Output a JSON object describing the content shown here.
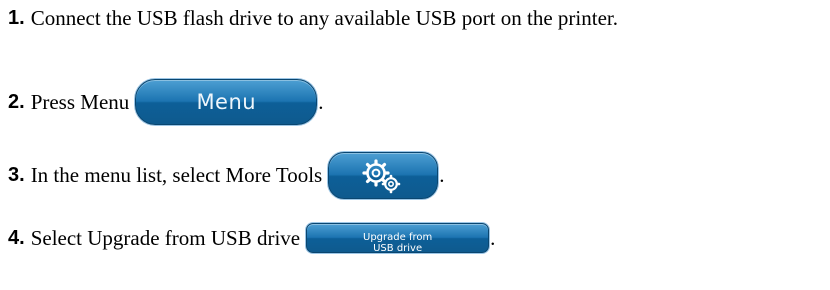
{
  "steps": [
    {
      "number": "1.",
      "text": "Connect the USB flash drive to any available USB port on the printer."
    },
    {
      "number": "2.",
      "text": "Press Menu",
      "button_label": "Menu",
      "suffix": "."
    },
    {
      "number": "3.",
      "text": "In the menu list, select More Tools",
      "button_icon": "gears-icon",
      "suffix": "."
    },
    {
      "number": "4.",
      "text": "Select Upgrade from USB drive",
      "button_label_line1": "Upgrade from",
      "button_label_line2": "USB drive",
      "suffix": "."
    }
  ],
  "colors": {
    "button_blue": "#1c74b1",
    "button_highlight": "#4d9fd3",
    "text": "#000000"
  }
}
